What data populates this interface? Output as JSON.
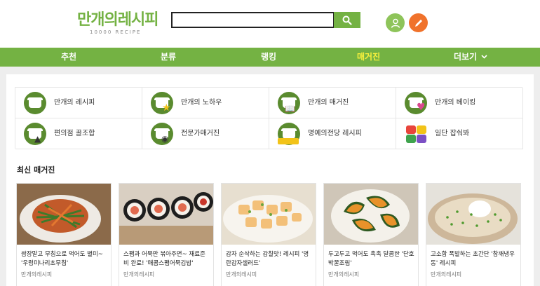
{
  "header": {
    "logo_text": "만개의레시피",
    "logo_sub": "10000 RECIPE",
    "search_value": "",
    "search_icon": "search-icon",
    "user_icon": "user-icon",
    "write_icon": "pencil-icon"
  },
  "nav": {
    "items": [
      "추천",
      "분류",
      "랭킹",
      "매거진",
      "더보기"
    ],
    "active": "매거진",
    "more_icon": "chevron-down-icon"
  },
  "categories": [
    {
      "label": "만개의 레시피",
      "icon": "pot-icon"
    },
    {
      "label": "만개의 노하우",
      "icon": "pot-star-icon"
    },
    {
      "label": "만개의 매거진",
      "icon": "pot-book-icon"
    },
    {
      "label": "만개의 베이킹",
      "icon": "pot-cupcake-icon"
    },
    {
      "label": "편의점 꿀조합",
      "icon": "pot-onigiri-icon"
    },
    {
      "label": "전문가매거진",
      "icon": "pot-chef-icon"
    },
    {
      "label": "명예의전당 레시피",
      "icon": "pot-9999-icon"
    },
    {
      "label": "일단 잡숴봐",
      "icon": "taste-logo-icon"
    }
  ],
  "section_title": "최신 매거진",
  "magazines": [
    {
      "title": "쌈장말고 무침으로 먹어도 별미~ '우렁미나리초무침'",
      "author": "만개의레시피"
    },
    {
      "title": "스팸과 어묵만 볶아주면~ 재료준비 완료! '매콤스팸어묵김밥'",
      "author": "만개의레시피"
    },
    {
      "title": "감자 순삭하는 감칠맛! 레시피 '명란감자샐러드'",
      "author": "만개의레시피"
    },
    {
      "title": "두고두고 먹어도 촉촉 달콤한 '단호박꿀조림'",
      "author": "만개의레시피"
    },
    {
      "title": "고소함 폭발하는 초간단 '참깨냉우동' 레시피",
      "author": "만개의레시피"
    }
  ],
  "colors": {
    "brand_green": "#74b243",
    "nav_active": "#f7f03c",
    "write_orange": "#f0722b"
  }
}
